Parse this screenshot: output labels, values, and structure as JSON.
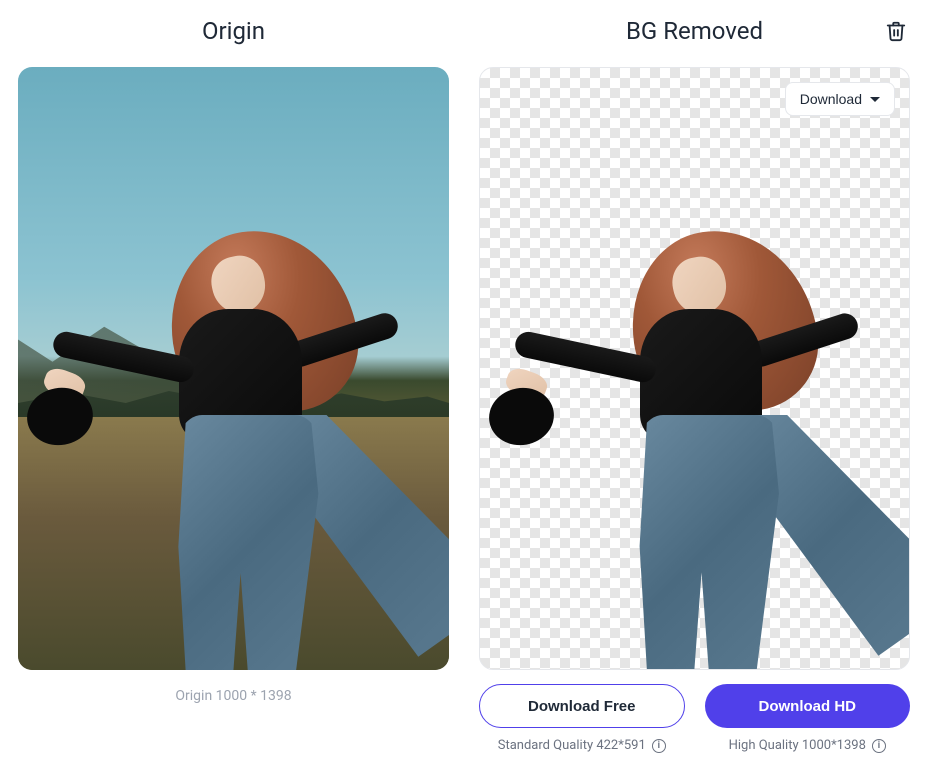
{
  "origin": {
    "title": "Origin",
    "caption": "Origin 1000 * 1398"
  },
  "removed": {
    "title": "BG Removed",
    "download_dropdown": "Download"
  },
  "buttons": {
    "free": {
      "label": "Download Free",
      "quality_text": "Standard Quality 422*591"
    },
    "hd": {
      "label": "Download HD",
      "quality_text": "High Quality 1000*1398"
    }
  },
  "icons": {
    "info": "i"
  }
}
